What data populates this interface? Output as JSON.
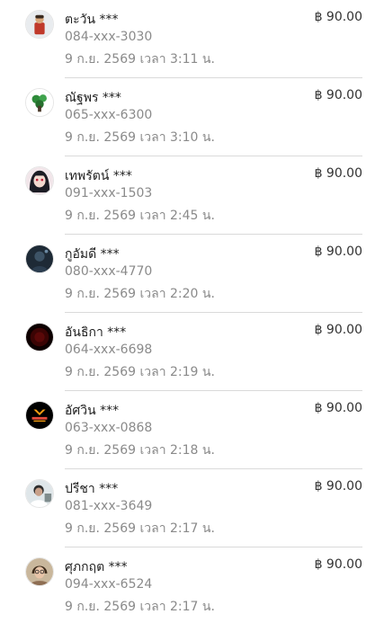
{
  "transactions": [
    {
      "name": "ตะวัน ***",
      "phone": "084-xxx-3030",
      "date": "9 ก.ย. 2569 เวลา 3:11 น.",
      "amount": "฿ 90.00",
      "avatar_icon": "person-red-shirt-icon"
    },
    {
      "name": "ณัฐพร ***",
      "phone": "065-xxx-6300",
      "date": "9 ก.ย. 2569 เวลา 3:10 น.",
      "amount": "฿ 90.00",
      "avatar_icon": "green-sticker-icon"
    },
    {
      "name": "เทพรัตน์ ***",
      "phone": "091-xxx-1503",
      "date": "9 ก.ย. 2569 เวลา 2:45 น.",
      "amount": "฿ 90.00",
      "avatar_icon": "anime-girl-icon"
    },
    {
      "name": "กูอัมดี ***",
      "phone": "080-xxx-4770",
      "date": "9 ก.ย. 2569 เวลา 2:20 น.",
      "amount": "฿ 90.00",
      "avatar_icon": "dark-person-icon"
    },
    {
      "name": "อันธิกา ***",
      "phone": "064-xxx-6698",
      "date": "9 ก.ย. 2569 เวลา 2:19 น.",
      "amount": "฿ 90.00",
      "avatar_icon": "dark-red-circle-icon"
    },
    {
      "name": "อัศวิน ***",
      "phone": "063-xxx-0868",
      "date": "9 ก.ย. 2569 เวลา 2:18 น.",
      "amount": "฿ 90.00",
      "avatar_icon": "orange-logo-icon"
    },
    {
      "name": "ปรีชา ***",
      "phone": "081-xxx-3649",
      "date": "9 ก.ย. 2569 เวลา 2:17 น.",
      "amount": "฿ 90.00",
      "avatar_icon": "person-photo-icon"
    },
    {
      "name": "ศุภกฤต ***",
      "phone": "094-xxx-6524",
      "date": "9 ก.ย. 2569 เวลา 2:17 น.",
      "amount": "฿ 90.00",
      "avatar_icon": "person-glasses-icon"
    }
  ],
  "colors": {
    "name": "#222222",
    "secondary_text": "#8a8a8a",
    "amount": "#333333",
    "divider": "#dadada"
  }
}
